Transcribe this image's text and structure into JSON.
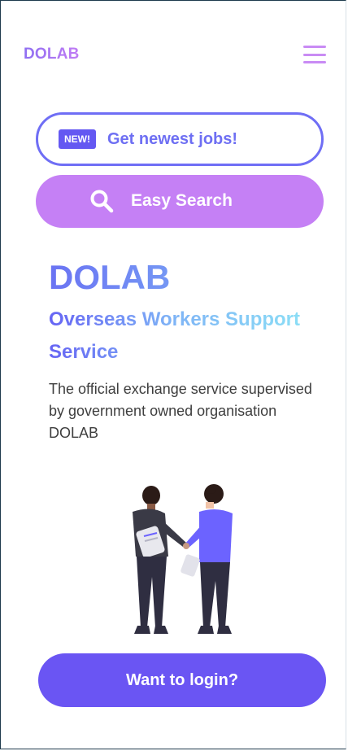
{
  "header": {
    "logo": "DOLAB",
    "menu_icon": "hamburger-menu-icon"
  },
  "jobs_button": {
    "badge": "NEW!",
    "label": "Get newest jobs!"
  },
  "search_button": {
    "label": "Easy Search",
    "icon": "search-icon"
  },
  "hero": {
    "title": "DOLAB",
    "subtitle": "Overseas Workers Support Service",
    "description": "The official exchange service supervised by government owned organisation DOLAB"
  },
  "illustration": {
    "icon": "handshake-illustration"
  },
  "login_button": {
    "label": "Want to login?"
  },
  "colors": {
    "purple": "#6a55f3",
    "lavender": "#c580f5",
    "blue_accent": "#6e6ff3",
    "cyan_accent": "#8ee6f6"
  }
}
